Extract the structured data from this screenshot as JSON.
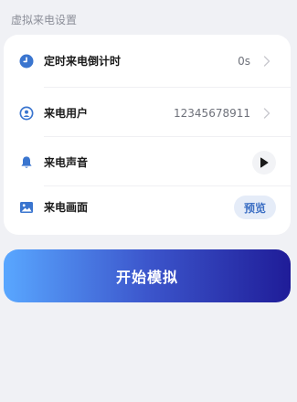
{
  "section": {
    "title": "虚拟来电设置"
  },
  "settings": {
    "rows": [
      {
        "icon": "clock-icon",
        "label": "定时来电倒计时",
        "value": "0s"
      },
      {
        "icon": "user-icon",
        "label": "来电用户",
        "value": "12345678911"
      },
      {
        "icon": "bell-icon",
        "label": "来电声音",
        "action_icon": "play-icon"
      },
      {
        "icon": "image-icon",
        "label": "来电画面",
        "action_label": "预览"
      }
    ]
  },
  "actions": {
    "start_label": "开始模拟"
  },
  "colors": {
    "accent_blue": "#3c6fc4",
    "icon_blue": "#3a75cf",
    "gradient_start": "#59a7ff",
    "gradient_end": "#1f1c98",
    "background": "#f0f1f5"
  }
}
